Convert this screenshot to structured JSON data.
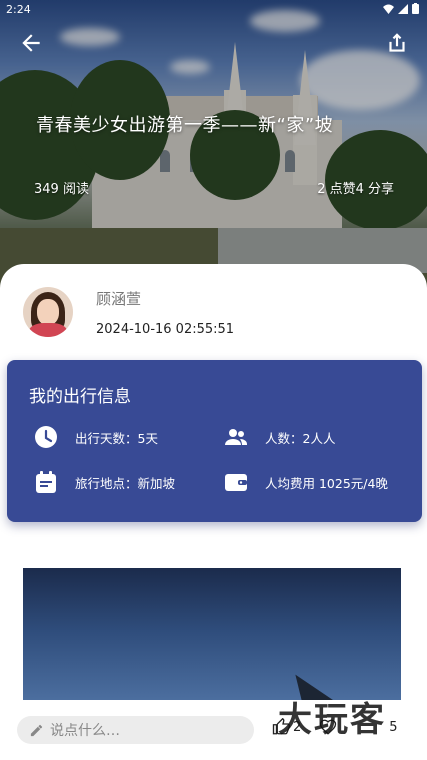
{
  "status_bar": {
    "time": "2:24"
  },
  "hero": {
    "title": "青春美少女出游第一季——新“家”坡",
    "reads": "349 阅读",
    "stats": "2 点赞4 分享"
  },
  "author": {
    "name": "顾涵萱",
    "date": "2024-10-16 02:55:51"
  },
  "travel_info": {
    "title": "我的出行信息",
    "days": "出行天数：5天",
    "people": "人数：2人人",
    "location": "旅行地点：新加坡",
    "cost": "人均费用 1025元/4晚"
  },
  "bottom_bar": {
    "comment_placeholder": "说点什么…",
    "like_count": "2",
    "share_count": "5",
    "watermark": "大玩家"
  },
  "colors": {
    "card": "#384a95",
    "accent": "#ffffff"
  }
}
